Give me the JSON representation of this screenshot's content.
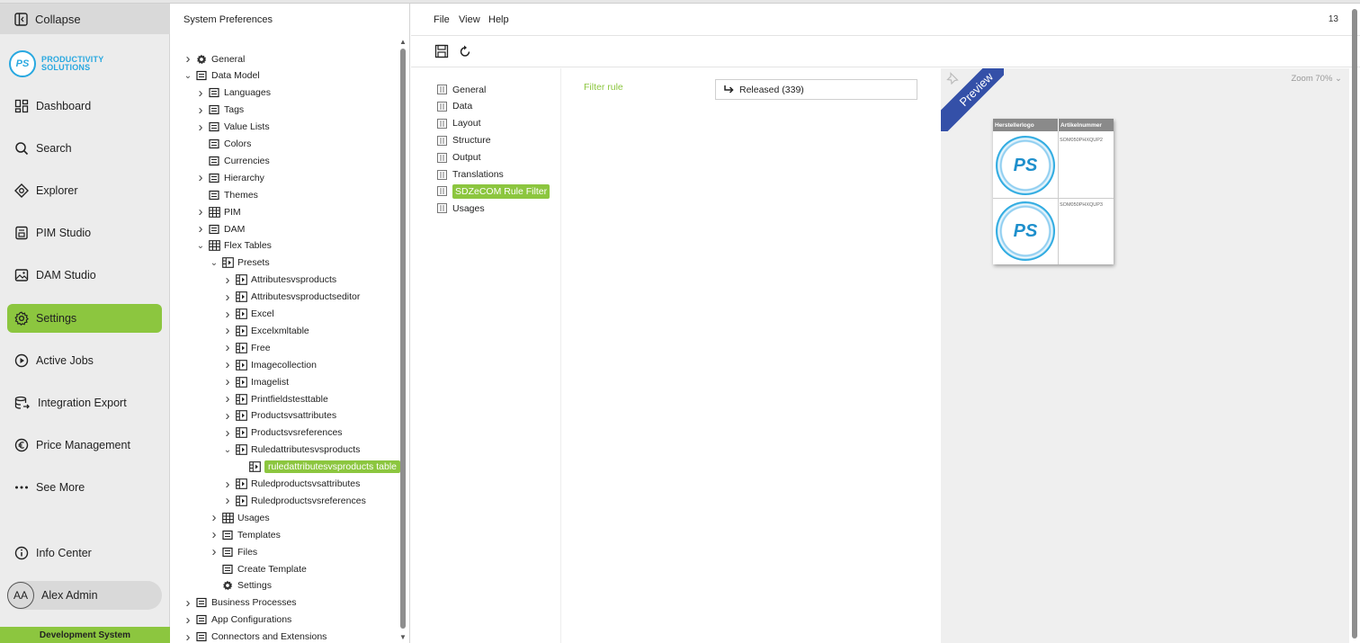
{
  "sidebar": {
    "collapse_label": "Collapse",
    "logo_line1": "PRODUCTIVITY",
    "logo_line2": "SOLUTIONS",
    "logo_mark": "PS",
    "items": [
      {
        "label": "Dashboard",
        "icon": "dashboard-icon"
      },
      {
        "label": "Search",
        "icon": "search-icon"
      },
      {
        "label": "Explorer",
        "icon": "explorer-icon"
      },
      {
        "label": "PIM Studio",
        "icon": "pim-studio-icon"
      },
      {
        "label": "DAM Studio",
        "icon": "image-icon"
      },
      {
        "label": "Settings",
        "icon": "gear-icon",
        "active": true
      },
      {
        "label": "Active Jobs",
        "icon": "play-icon"
      },
      {
        "label": "Integration Export",
        "icon": "database-icon"
      },
      {
        "label": "Price Management",
        "icon": "euro-icon"
      },
      {
        "label": "See More",
        "icon": "more-icon"
      }
    ],
    "info_center": "Info Center",
    "user_initials": "AA",
    "user_name": "Alex Admin",
    "environment": "Development System",
    "accent_color": "#8cc63f"
  },
  "tree": {
    "title": "System Preferences",
    "rows": [
      {
        "label": "General",
        "depth": 0,
        "chev": ">",
        "icon": "gear-icon"
      },
      {
        "label": "Data Model",
        "depth": 0,
        "chev": "v",
        "icon": "data-model-icon"
      },
      {
        "label": "Languages",
        "depth": 1,
        "chev": ">",
        "icon": "flag-icon"
      },
      {
        "label": "Tags",
        "depth": 1,
        "chev": ">",
        "icon": "tag-icon"
      },
      {
        "label": "Value Lists",
        "depth": 1,
        "chev": ">",
        "icon": "list-icon"
      },
      {
        "label": "Colors",
        "depth": 1,
        "chev": "",
        "icon": "colors-icon"
      },
      {
        "label": "Currencies",
        "depth": 1,
        "chev": "",
        "icon": "currency-icon"
      },
      {
        "label": "Hierarchy",
        "depth": 1,
        "chev": ">",
        "icon": "hierarchy-icon"
      },
      {
        "label": "Themes",
        "depth": 1,
        "chev": "",
        "icon": "theme-icon"
      },
      {
        "label": "PIM",
        "depth": 1,
        "chev": ">",
        "icon": "table-icon"
      },
      {
        "label": "DAM",
        "depth": 1,
        "chev": ">",
        "icon": "image-icon"
      },
      {
        "label": "Flex Tables",
        "depth": 1,
        "chev": "v",
        "icon": "table-icon"
      },
      {
        "label": "Presets",
        "depth": 2,
        "chev": "v",
        "icon": "preset-icon"
      },
      {
        "label": "Attributesvsproducts",
        "depth": 3,
        "chev": ">",
        "icon": "preset-icon"
      },
      {
        "label": "Attributesvsproductseditor",
        "depth": 3,
        "chev": ">",
        "icon": "preset-icon"
      },
      {
        "label": "Excel",
        "depth": 3,
        "chev": ">",
        "icon": "preset-icon"
      },
      {
        "label": "Excelxmltable",
        "depth": 3,
        "chev": ">",
        "icon": "preset-icon"
      },
      {
        "label": "Free",
        "depth": 3,
        "chev": ">",
        "icon": "preset-icon"
      },
      {
        "label": "Imagecollection",
        "depth": 3,
        "chev": ">",
        "icon": "preset-icon"
      },
      {
        "label": "Imagelist",
        "depth": 3,
        "chev": ">",
        "icon": "preset-icon"
      },
      {
        "label": "Printfieldstesttable",
        "depth": 3,
        "chev": ">",
        "icon": "preset-icon"
      },
      {
        "label": "Productsvsattributes",
        "depth": 3,
        "chev": ">",
        "icon": "preset-icon"
      },
      {
        "label": "Productsvsreferences",
        "depth": 3,
        "chev": ">",
        "icon": "preset-icon"
      },
      {
        "label": "Ruledattributesvsproducts",
        "depth": 3,
        "chev": "v",
        "icon": "preset-icon"
      },
      {
        "label": "ruledattributesvsproducts table",
        "depth": 4,
        "chev": "",
        "icon": "preset-icon",
        "selected": true
      },
      {
        "label": "Ruledproductsvsattributes",
        "depth": 3,
        "chev": ">",
        "icon": "preset-icon"
      },
      {
        "label": "Ruledproductsvsreferences",
        "depth": 3,
        "chev": ">",
        "icon": "preset-icon"
      },
      {
        "label": "Usages",
        "depth": 2,
        "chev": ">",
        "icon": "table-icon"
      },
      {
        "label": "Templates",
        "depth": 2,
        "chev": ">",
        "icon": "template-icon"
      },
      {
        "label": "Files",
        "depth": 2,
        "chev": ">",
        "icon": "file-icon"
      },
      {
        "label": "Create Template",
        "depth": 2,
        "chev": "",
        "icon": "plus-circle-icon"
      },
      {
        "label": "Settings",
        "depth": 2,
        "chev": "",
        "icon": "gear-icon"
      },
      {
        "label": "Business Processes",
        "depth": 0,
        "chev": ">",
        "icon": "process-icon"
      },
      {
        "label": "App Configurations",
        "depth": 0,
        "chev": ">",
        "icon": "monitor-icon"
      },
      {
        "label": "Connectors and Extensions",
        "depth": 0,
        "chev": ">",
        "icon": "puzzle-icon"
      }
    ]
  },
  "menu": {
    "file": "File",
    "view": "View",
    "help": "Help",
    "corner_number": "13"
  },
  "toolbar": {
    "save_icon": "save-icon",
    "reload_icon": "reload-icon"
  },
  "subnav": {
    "items": [
      {
        "label": "General"
      },
      {
        "label": "Data"
      },
      {
        "label": "Layout"
      },
      {
        "label": "Structure"
      },
      {
        "label": "Output"
      },
      {
        "label": "Translations"
      },
      {
        "label": "SDZeCOM Rule Filter",
        "selected": true
      },
      {
        "label": "Usages"
      }
    ]
  },
  "filter": {
    "label": "Filter rule",
    "value": "Released (339)"
  },
  "preview": {
    "ribbon": "Preview",
    "zoom": "Zoom 70%",
    "col1": "Herstellerlogo",
    "col2": "Artikelnummer",
    "rows": [
      {
        "art": "SOM050PHXQUP2",
        "logo": "PS"
      },
      {
        "art": "SOM050PHXQUP3",
        "logo": "PS"
      }
    ]
  }
}
